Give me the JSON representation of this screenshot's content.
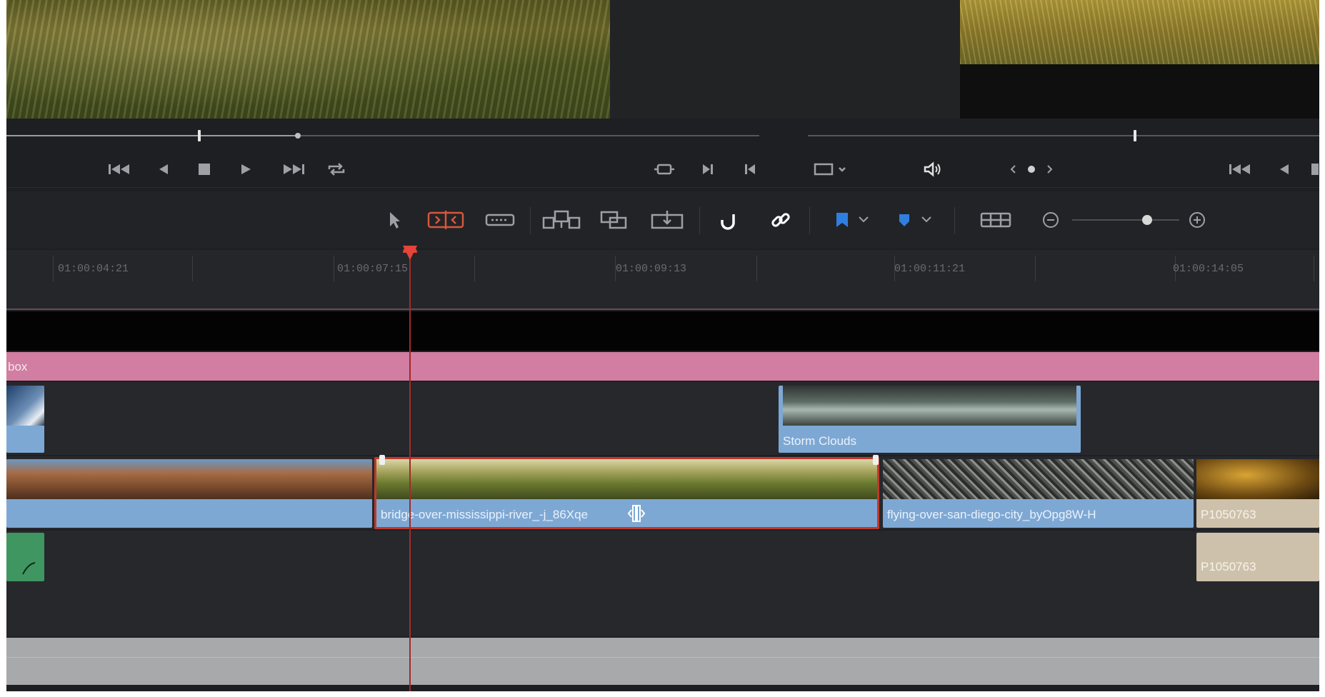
{
  "timeline": {
    "ruler_timecodes": [
      "01:00:04:21",
      "01:00:07:15",
      "01:00:09:13",
      "01:00:11:21",
      "01:00:14:05"
    ],
    "title_track_label": "box",
    "clips": {
      "storm_clouds": "Storm Clouds",
      "bridge": "bridge-over-mississippi-river_-j_86Xqe",
      "flying": "flying-over-san-diego-city_byOpg8W-H",
      "p1": "P1050763",
      "p2": "P1050763"
    }
  },
  "colors": {
    "playhead": "#e6433a",
    "clip_video": "#7ea8d4",
    "clip_title_track": "#d17ea2",
    "clip_audio": "#cec1ab",
    "trim_tool_active": "#d6573a",
    "flag_blue": "#2f7fe0"
  },
  "icons": {
    "transport_left": [
      "jump-to-start-icon",
      "reverse-play-icon",
      "stop-icon",
      "play-icon",
      "jump-to-end-icon",
      "loop-icon"
    ],
    "transport_right": [
      "match-frame-icon",
      "next-edit-icon",
      "previous-edit-icon",
      "viewer-size-icon",
      "audio-icon",
      "jog-icon"
    ],
    "toolbar": [
      "selection-mode-icon",
      "trim-edit-mode-icon",
      "blade-edit-mode-icon",
      "insert-clip-icon",
      "overwrite-clip-icon",
      "replace-clip-icon",
      "snapping-icon",
      "linked-selection-icon",
      "flag-icon",
      "marker-icon",
      "timeline-view-options-icon",
      "zoom-out-icon",
      "zoom-in-icon"
    ]
  }
}
